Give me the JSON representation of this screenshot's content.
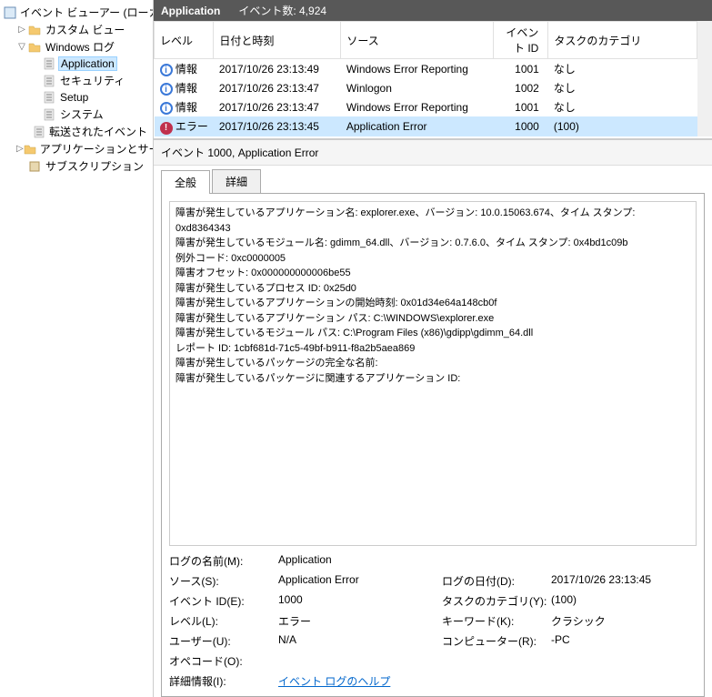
{
  "tree": {
    "root": "イベント ビューアー (ローカル)",
    "items": [
      {
        "label": "カスタム ビュー",
        "expander": "▷",
        "icon": "folder"
      },
      {
        "label": "Windows ログ",
        "expander": "▽",
        "icon": "folder"
      },
      {
        "label": "Application",
        "icon": "log",
        "indent": 2,
        "selected": true
      },
      {
        "label": "セキュリティ",
        "icon": "log",
        "indent": 2
      },
      {
        "label": "Setup",
        "icon": "log",
        "indent": 2
      },
      {
        "label": "システム",
        "icon": "log",
        "indent": 2
      },
      {
        "label": "転送されたイベント",
        "icon": "log",
        "indent": 2
      },
      {
        "label": "アプリケーションとサービス ログ",
        "expander": "▷",
        "icon": "folder",
        "indent": 0
      },
      {
        "label": "サブスクリプション",
        "icon": "sub",
        "indent": 0
      }
    ]
  },
  "header": {
    "title": "Application",
    "count_label": "イベント数: 4,924"
  },
  "columns": {
    "level": "レベル",
    "date": "日付と時刻",
    "source": "ソース",
    "id": "イベント ID",
    "task": "タスクのカテゴリ"
  },
  "rows": [
    {
      "level": "情報",
      "icon": "info",
      "date": "2017/10/26 23:13:49",
      "source": "Windows Error Reporting",
      "id": "1001",
      "task": "なし"
    },
    {
      "level": "情報",
      "icon": "info",
      "date": "2017/10/26 23:13:47",
      "source": "Winlogon",
      "id": "1002",
      "task": "なし"
    },
    {
      "level": "情報",
      "icon": "info",
      "date": "2017/10/26 23:13:47",
      "source": "Windows Error Reporting",
      "id": "1001",
      "task": "なし"
    },
    {
      "level": "エラー",
      "icon": "error",
      "date": "2017/10/26 23:13:45",
      "source": "Application Error",
      "id": "1000",
      "task": "(100)",
      "selected": true
    }
  ],
  "detail": {
    "header": "イベント 1000, Application Error",
    "tabs": {
      "general": "全般",
      "detail": "詳細"
    },
    "text": "障害が発生しているアプリケーション名: explorer.exe、バージョン: 10.0.15063.674、タイム スタンプ: 0xd8364343\n障害が発生しているモジュール名: gdimm_64.dll、バージョン: 0.7.6.0、タイム スタンプ: 0x4bd1c09b\n例外コード: 0xc0000005\n障害オフセット: 0x000000000006be55\n障害が発生しているプロセス ID: 0x25d0\n障害が発生しているアプリケーションの開始時刻: 0x01d34e64a148cb0f\n障害が発生しているアプリケーション パス: C:\\WINDOWS\\explorer.exe\n障害が発生しているモジュール パス: C:\\Program Files (x86)\\gdipp\\gdimm_64.dll\nレポート ID: 1cbf681d-71c5-49bf-b911-f8a2b5aea869\n障害が発生しているパッケージの完全な名前:\n障害が発生しているパッケージに関連するアプリケーション ID:",
    "props": {
      "log_name_l": "ログの名前(M):",
      "log_name_v": "Application",
      "source_l": "ソース(S):",
      "source_v": "Application Error",
      "log_date_l": "ログの日付(D):",
      "log_date_v": "2017/10/26 23:13:45",
      "event_id_l": "イベント ID(E):",
      "event_id_v": "1000",
      "task_cat_l": "タスクのカテゴリ(Y):",
      "task_cat_v": "(100)",
      "level_l": "レベル(L):",
      "level_v": "エラー",
      "keyword_l": "キーワード(K):",
      "keyword_v": "クラシック",
      "user_l": "ユーザー(U):",
      "user_v": "N/A",
      "computer_l": "コンピューター(R):",
      "computer_v": "-PC",
      "opcode_l": "オペコード(O):",
      "moreinfo_l": "詳細情報(I):",
      "moreinfo_link": "イベント ログのヘルプ"
    }
  }
}
